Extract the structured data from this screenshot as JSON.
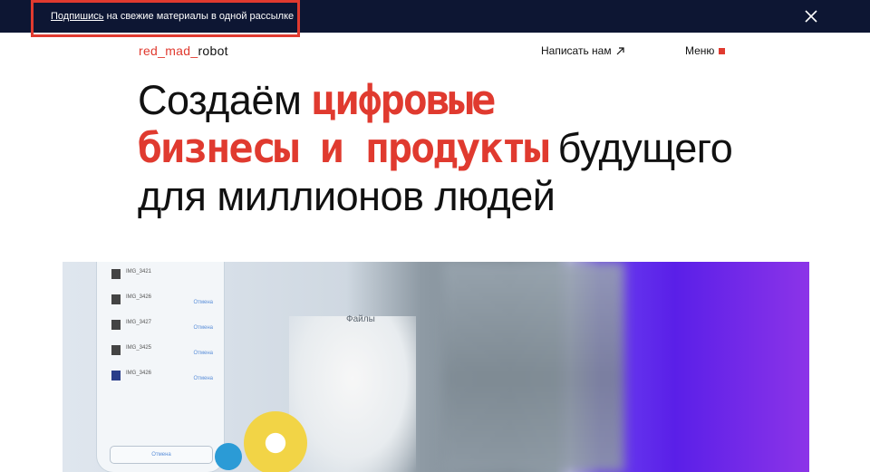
{
  "banner": {
    "link": "Подпишись",
    "text": " на свежие материалы в одной рассылке",
    "close_icon": "close-icon"
  },
  "header": {
    "logo_red_1": "red_mad_",
    "logo_dark": "robot",
    "contact": "Написать нам",
    "contact_icon": "arrow-up-right-icon",
    "menu": "Меню",
    "menu_icon": "square-icon"
  },
  "hero": {
    "part1": "Создаём ",
    "accent1": "цифровые",
    "accent2": "бизнесы и продукты",
    "part2": " будущего",
    "part3": "для миллионов людей"
  },
  "media": {
    "files_label": "Файлы",
    "rows": [
      {
        "name": "IMG_3421",
        "action": ""
      },
      {
        "name": "IMG_3426",
        "action": "Отмена"
      },
      {
        "name": "IMG_3427",
        "action": "Отмена"
      },
      {
        "name": "IMG_3425",
        "action": "Отмена"
      },
      {
        "name": "IMG_3426",
        "action": "Отмена"
      }
    ],
    "button": "Отмена"
  },
  "colors": {
    "banner_bg": "#0d1633",
    "accent": "#e03a2f",
    "text": "#111111"
  }
}
